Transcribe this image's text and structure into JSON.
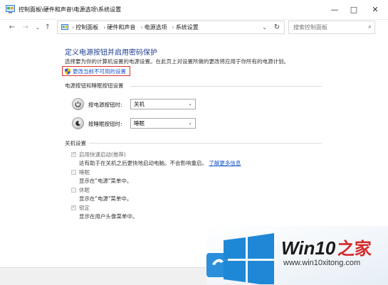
{
  "title_bar": {
    "title": "控制面板\\硬件和声音\\电源选项\\系统设置",
    "minimize": "—",
    "maximize": "□",
    "close": "✕"
  },
  "address_bar": {
    "back": "←",
    "forward": "→",
    "recent": "⌄",
    "up": "↑",
    "breadcrumbs": [
      "控制面板",
      "硬件和声音",
      "电源选项",
      "系统设置"
    ],
    "separator": "›",
    "dropdown": "⌄",
    "refresh": "↻",
    "search_placeholder": "搜索控制面板",
    "search_icon_glyph": "⌕"
  },
  "main": {
    "heading": "定义电源按钮并启用密码保护",
    "description": "选择要为你的计算机设置的电源设置。在此页上对设置所做的更改将应用于你所有的电源计划。",
    "change_settings_link": "更改当前不可用的设置",
    "power_buttons_section": {
      "title": "电源按钮和睡眠按钮设置",
      "rows": [
        {
          "label": "按电源按钮时:",
          "value": "关机"
        },
        {
          "label": "按睡眠按钮时:",
          "value": "睡眠"
        }
      ]
    },
    "shutdown_section": {
      "title": "关机设置",
      "options": [
        {
          "label": "启用快速启动(推荐)",
          "checked": true,
          "description": "这有助于在关机之后更快地启动电脑。不会影响重启。",
          "link": "了解更多信息"
        },
        {
          "label": "睡眠",
          "checked": false,
          "description": "显示在\"电源\"菜单中。"
        },
        {
          "label": "休眠",
          "checked": false,
          "description": "显示在\"电源\"菜单中。"
        },
        {
          "label": "锁定",
          "checked": true,
          "description": "显示在用户头像菜单中。"
        }
      ]
    }
  },
  "watermark": {
    "brand": "Win10",
    "brand_suffix": "之家",
    "url": "www.win10xitong.com",
    "colors": {
      "blue": "#1e88d6",
      "dark": "#1a1a1a",
      "red": "#d42a2a"
    }
  }
}
